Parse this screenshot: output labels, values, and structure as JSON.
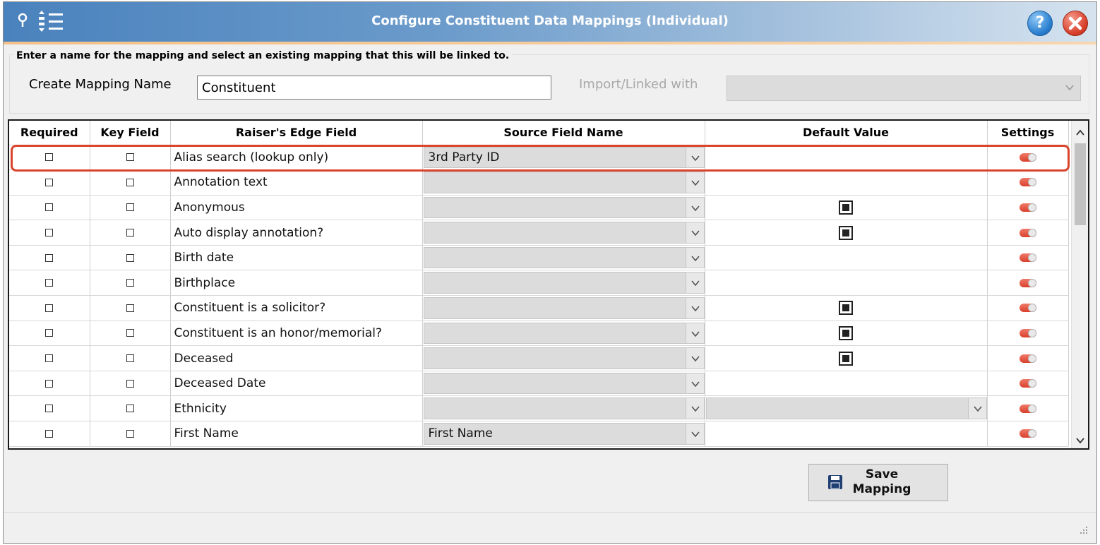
{
  "window": {
    "title": "Configure Constituent Data Mappings (Individual)",
    "help_icon": "question-icon",
    "close_icon": "close-x-icon"
  },
  "mapping": {
    "instructions": "Enter a name for the mapping and select an existing mapping that this will be linked to.",
    "create_label": "Create Mapping Name",
    "name_value": "Constituent",
    "import_label": "Import/Linked with",
    "import_value": ""
  },
  "grid": {
    "columns": [
      "Required",
      "Key Field",
      "Raiser's Edge Field",
      "Source Field Name",
      "Default Value",
      "Settings"
    ],
    "rows": [
      {
        "field": "Alias search (lookup only)",
        "source": "3rd Party ID",
        "default": "empty"
      },
      {
        "field": "Annotation text",
        "source": "",
        "default": "empty"
      },
      {
        "field": "Anonymous",
        "source": "",
        "default": "checkbox"
      },
      {
        "field": "Auto display annotation?",
        "source": "",
        "default": "checkbox"
      },
      {
        "field": "Birth date",
        "source": "",
        "default": "empty"
      },
      {
        "field": "Birthplace",
        "source": "",
        "default": "empty"
      },
      {
        "field": "Constituent is a solicitor?",
        "source": "",
        "default": "checkbox"
      },
      {
        "field": "Constituent is an honor/memorial?",
        "source": "",
        "default": "checkbox"
      },
      {
        "field": "Deceased",
        "source": "",
        "default": "checkbox"
      },
      {
        "field": "Deceased Date",
        "source": "",
        "default": "empty"
      },
      {
        "field": "Ethnicity",
        "source": "",
        "default": "dropdown"
      },
      {
        "field": "First Name",
        "source": "First Name",
        "default": "empty"
      }
    ],
    "highlighted_row": 0
  },
  "actions": {
    "save_label_line1": "Save",
    "save_label_line2": "Mapping",
    "save_icon": "floppy-disk-icon"
  },
  "colors": {
    "title_gradient_start": "#4a82bd",
    "title_accent": "#f3c089",
    "highlight": "#d9442c",
    "dropdown_bg": "#dcdcdc",
    "toggle_red": "#d8402c"
  }
}
